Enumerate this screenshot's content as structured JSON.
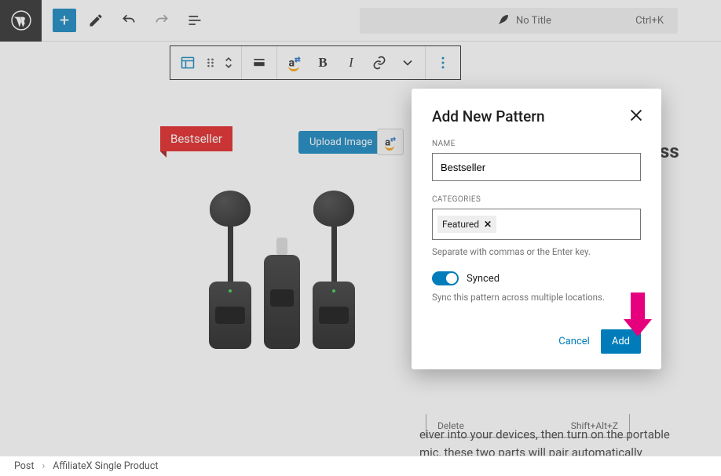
{
  "topbar": {
    "title_placeholder": "No Title",
    "shortcut": "Ctrl+K"
  },
  "block_toolbar": {
    "bold": "B",
    "italic": "I"
  },
  "product": {
    "ribbon_label": "Bestseller",
    "upload_label": "Upload Image",
    "body_text": "eiver into your devices, then turn on the portable mic, these two parts will pair automatically"
  },
  "menu_remnant": {
    "left": "Delete",
    "right": "Shift+Alt+Z"
  },
  "right_peek": "ss",
  "modal": {
    "title": "Add New Pattern",
    "name_label": "NAME",
    "name_value": "Bestseller",
    "categories_label": "CATEGORIES",
    "category_chip": "Featured",
    "categories_help": "Separate with commas or the Enter key.",
    "synced_label": "Synced",
    "synced_help": "Sync this pattern across multiple locations.",
    "cancel_label": "Cancel",
    "add_label": "Add"
  },
  "breadcrumb": {
    "root": "Post",
    "current": "AffiliateX Single Product"
  }
}
